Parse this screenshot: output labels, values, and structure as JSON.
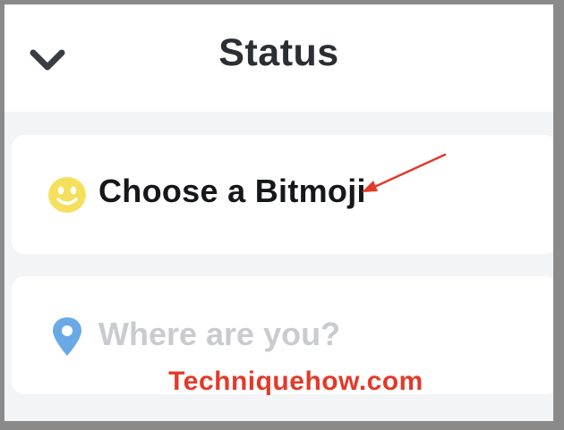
{
  "header": {
    "title": "Status",
    "back_icon": "chevron-down-icon"
  },
  "bitmoji_option": {
    "label": "Choose a Bitmoji",
    "icon": "bitmoji-face-icon",
    "icon_color": "#f5e05e"
  },
  "location_option": {
    "placeholder": "Where are you?",
    "icon": "location-pin-icon",
    "icon_color": "#6aa9e6"
  },
  "annotation": {
    "arrow_color": "#e23a2a",
    "watermark": "Techniquehow.com"
  }
}
